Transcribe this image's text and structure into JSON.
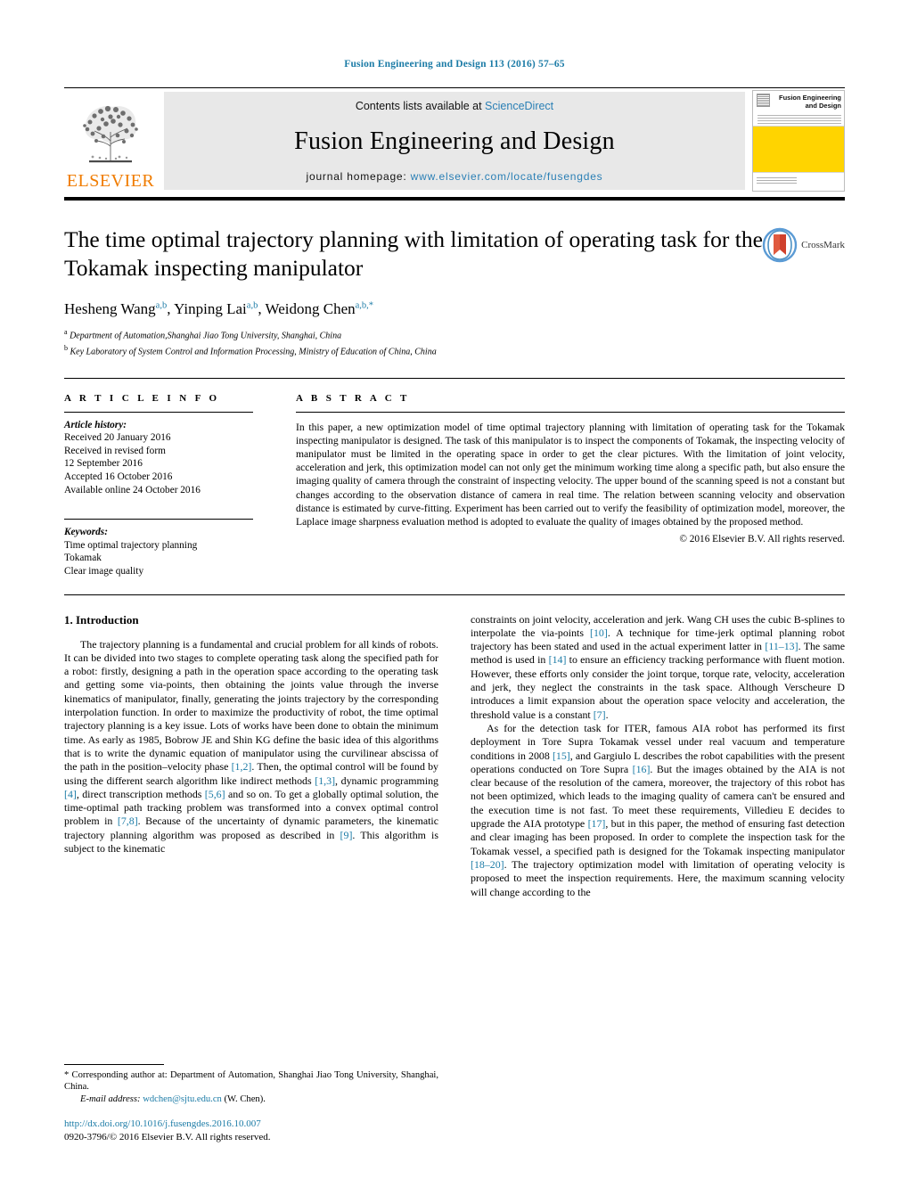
{
  "running_head": "Fusion Engineering and Design 113 (2016) 57–65",
  "masthead": {
    "publisher_name": "ELSEVIER",
    "contents_prefix": "Contents lists available at ",
    "contents_link": "ScienceDirect",
    "journal_title": "Fusion Engineering and Design",
    "homepage_prefix": "journal homepage: ",
    "homepage_url": "www.elsevier.com/locate/fusengdes",
    "cover_title_line1": "Fusion Engineering",
    "cover_title_line2": "and Design"
  },
  "article": {
    "title": "The time optimal trajectory planning with limitation of operating task for the Tokamak inspecting manipulator",
    "crossmark_label": "CrossMark",
    "authors": [
      {
        "name": "Hesheng Wang",
        "marks": "a,b",
        "sep": ", "
      },
      {
        "name": "Yinping Lai",
        "marks": "a,b",
        "sep": ", "
      },
      {
        "name": "Weidong Chen",
        "marks": "a,b,",
        "star": "*",
        "sep": ""
      }
    ],
    "affiliations": [
      {
        "mark": "a",
        "text": "Department of Automation,Shanghai Jiao Tong University, Shanghai, China"
      },
      {
        "mark": "b",
        "text": "Key Laboratory of System Control and Information Processing, Ministry of Education of China, China"
      }
    ]
  },
  "article_info": {
    "heading": "A R T I C L E   I N F O",
    "history_label": "Article history:",
    "history": [
      "Received 20 January 2016",
      "Received in revised form",
      "12 September 2016",
      "Accepted 16 October 2016",
      "Available online 24 October 2016"
    ],
    "keywords_label": "Keywords:",
    "keywords": [
      "Time optimal trajectory planning",
      "Tokamak",
      "Clear image quality"
    ]
  },
  "abstract": {
    "heading": "A B S T R A C T",
    "text": "In this paper, a new optimization model of time optimal trajectory planning with limitation of operating task for the Tokamak inspecting manipulator is designed. The task of this manipulator is to inspect the components of Tokamak, the inspecting velocity of manipulator must be limited in the operating space in order to get the clear pictures. With the limitation of joint velocity, acceleration and jerk, this optimization model can not only get the minimum working time along a specific path, but also ensure the imaging quality of camera through the constraint of inspecting velocity. The upper bound of the scanning speed is not a constant but changes according to the observation distance of camera in real time. The relation between scanning velocity and observation distance is estimated by curve-fitting. Experiment has been carried out to verify the feasibility of optimization model, moreover, the Laplace image sharpness evaluation method is adopted to evaluate the quality of images obtained by the proposed method.",
    "copyright": "© 2016 Elsevier B.V. All rights reserved."
  },
  "body": {
    "section_number_title": "1.  Introduction",
    "left_paragraph_1_part1": "The trajectory planning is a fundamental and crucial problem for all kinds of robots. It can be divided into two stages to complete operating task along the specified path for a robot: firstly, designing a path in the operation space according to the operating task and getting some via-points, then obtaining the joints value through the inverse kinematics of manipulator, finally, generating the joints trajectory by the corresponding interpolation function. In order to maximize the productivity of robot, the time optimal trajectory planning is a key issue. Lots of works have been done to obtain the minimum time. As early as 1985, Bobrow JE and Shin KG define the basic idea of this algorithms that is to write the dynamic equation of manipulator using the curvilinear abscissa of the path in the position–velocity phase ",
    "ref_1_2": "[1,2]",
    "left_paragraph_1_part2": ". Then, the optimal control will be found by using the different search algorithm like indirect methods ",
    "ref_1_3": "[1,3]",
    "left_paragraph_1_part3": ", dynamic programming ",
    "ref_4": "[4]",
    "left_paragraph_1_part4": ", direct transcription methods ",
    "ref_5_6": "[5,6]",
    "left_paragraph_1_part5": " and so on. To get a globally optimal solution, the time-optimal path tracking problem was transformed into a convex optimal control problem in ",
    "ref_7_8": "[7,8]",
    "left_paragraph_1_part6": ". Because of the uncertainty of dynamic parameters, the kinematic trajectory planning algorithm was proposed as described in ",
    "ref_9": "[9]",
    "left_paragraph_1_part7": ". This algorithm is subject to the kinematic ",
    "right_paragraph_1_part1": "constraints on joint velocity, acceleration and jerk. Wang CH uses the cubic B-splines to interpolate the via-points ",
    "ref_10": "[10]",
    "right_paragraph_1_part2": ". A technique for time-jerk optimal planning robot trajectory has been stated and used in the actual experiment latter in ",
    "ref_11_13": "[11–13]",
    "right_paragraph_1_part3": ". The same method is used in ",
    "ref_14": "[14]",
    "right_paragraph_1_part4": " to ensure an efficiency tracking performance with fluent motion. However, these efforts only consider the joint torque, torque rate, velocity, acceleration and jerk, they neglect the constraints in the task space. Although Verscheure D introduces a limit expansion about the operation space velocity and acceleration, the threshold value is a constant ",
    "ref_7": "[7]",
    "right_paragraph_1_part5": ".",
    "right_paragraph_2_part1": "As for the detection task for ITER, famous AIA robot has performed its first deployment in Tore Supra Tokamak vessel under real vacuum and temperature conditions in 2008 ",
    "ref_15": "[15]",
    "right_paragraph_2_part2": ", and Gargiulo L describes the robot capabilities with the present operations conducted on Tore Supra ",
    "ref_16": "[16]",
    "right_paragraph_2_part3": ". But the images obtained by the AIA is not clear because of the resolution of the camera, moreover, the trajectory of this robot has not been optimized, which leads to the imaging quality of camera can't be ensured and the execution time is not fast. To meet these requirements, Villedieu E decides to upgrade the AIA prototype ",
    "ref_17": "[17]",
    "right_paragraph_2_part4": ", but in this paper, the method of ensuring fast detection and clear imaging has been proposed. In order to complete the inspection task for the Tokamak vessel, a specified path is designed for the Tokamak inspecting manipulator ",
    "ref_18_20": "[18–20]",
    "right_paragraph_2_part5": ". The trajectory optimization model with limitation of operating velocity is proposed to meet the inspection requirements. Here, the maximum scanning velocity will change according to the"
  },
  "footer": {
    "corresponding_note": "* Corresponding author at: Department of Automation, Shanghai Jiao Tong University, Shanghai, China.",
    "email_label": "E-mail address:",
    "email": "wdchen@sjtu.edu.cn",
    "email_suffix": "(W. Chen).",
    "doi": "http://dx.doi.org/10.1016/j.fusengdes.2016.10.007",
    "issn_line": "0920-3796/© 2016 Elsevier B.V. All rights reserved."
  },
  "colors": {
    "link_blue": "#1b7ba6",
    "elsevier_orange": "#f07c00",
    "cover_yellow": "#ffd400",
    "banner_gray": "#e8e8e8"
  }
}
